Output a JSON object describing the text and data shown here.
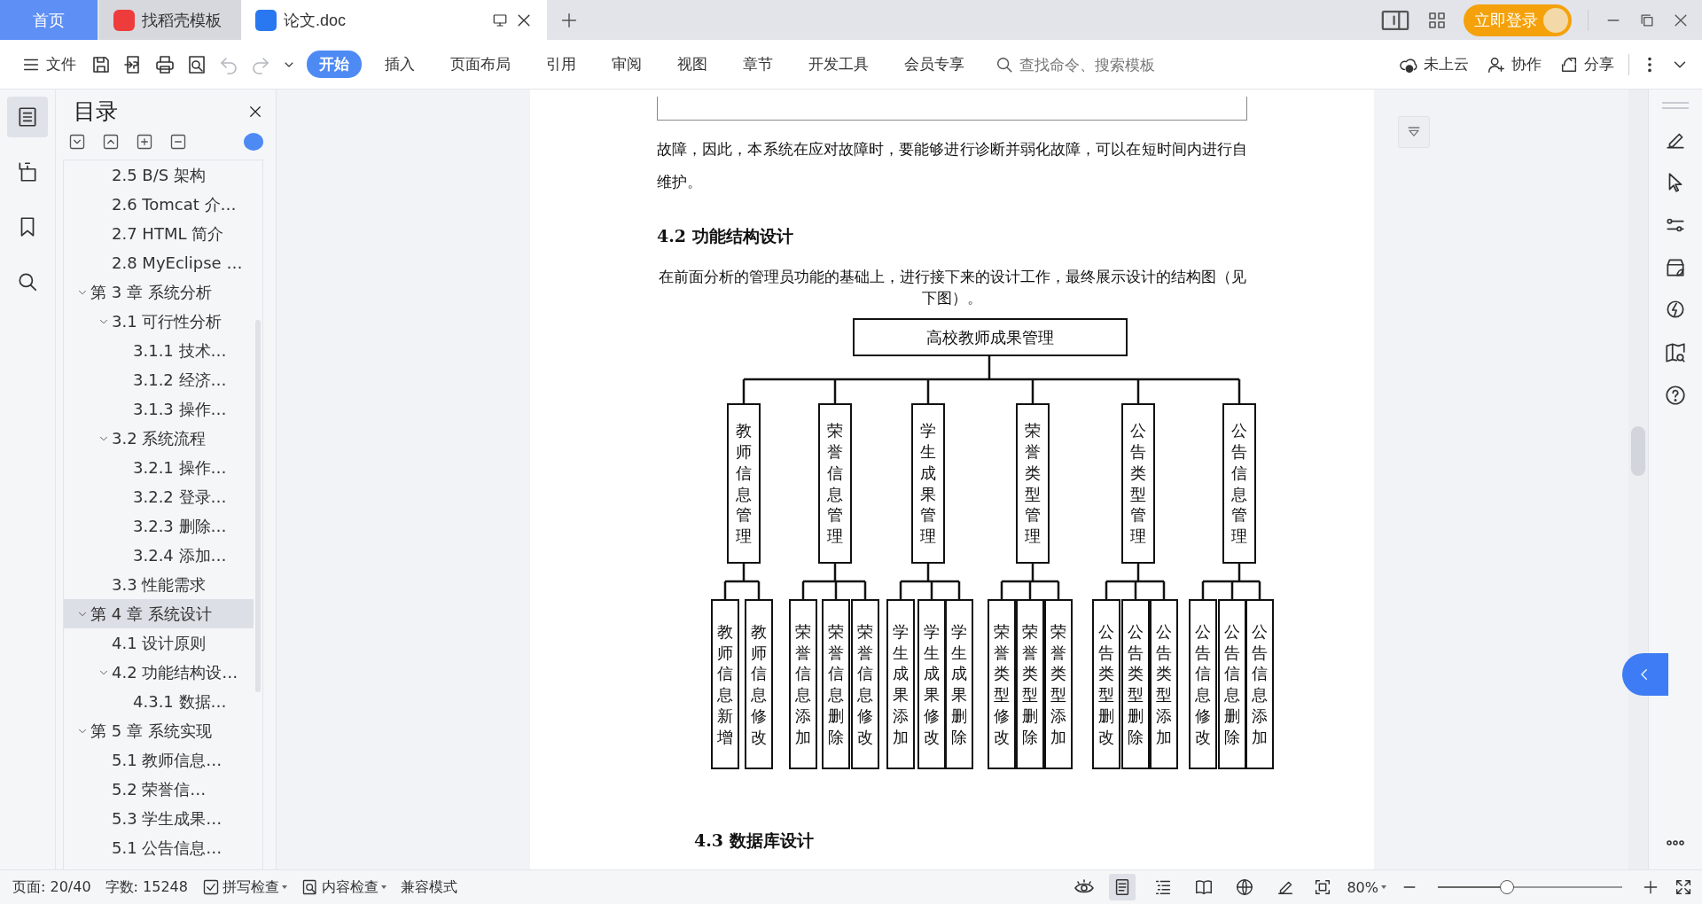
{
  "title_tabs": [
    {
      "kind": "home",
      "label": "首页",
      "selected": false
    },
    {
      "kind": "template",
      "label": "找稻壳模板",
      "selected": false
    },
    {
      "kind": "document",
      "label": "论文.doc",
      "selected": true
    }
  ],
  "login_button": "立即登录",
  "file_menu": "文件",
  "undo": {
    "disabled": true
  },
  "redo": {
    "disabled": true
  },
  "ribbon_tabs": [
    {
      "label": "开始",
      "selected": true
    },
    {
      "label": "插入",
      "selected": false
    },
    {
      "label": "页面布局",
      "selected": false
    },
    {
      "label": "引用",
      "selected": false
    },
    {
      "label": "审阅",
      "selected": false
    },
    {
      "label": "视图",
      "selected": false
    },
    {
      "label": "章节",
      "selected": false
    },
    {
      "label": "开发工具",
      "selected": false
    },
    {
      "label": "会员专享",
      "selected": false
    }
  ],
  "search": {
    "placeholder": "查找命令、搜索模板"
  },
  "toolbar_actions": [
    "未上云",
    "协作",
    "分享"
  ],
  "left_rail": [
    {
      "selected": true
    },
    {
      "selected": false
    },
    {
      "selected": false
    },
    {
      "selected": false
    }
  ],
  "toc": {
    "title": "目录",
    "continued": [
      {
        "label": "2.5 B/S 架构",
        "selected": false
      },
      {
        "label": "2.6 Tomcat 介…",
        "selected": false
      },
      {
        "label": "2.7 HTML 简介",
        "selected": false
      },
      {
        "label": "2.8 MyEclipse …",
        "selected": false
      }
    ],
    "items": [
      {
        "label": "第 3 章  系统分析",
        "selected": false,
        "expanded": true,
        "children": [
          {
            "label": "3.1  可行性分析",
            "selected": false,
            "expanded": true,
            "children": [
              {
                "label": "3.1.1  技术…",
                "selected": false
              },
              {
                "label": "3.1.2  经济…",
                "selected": false
              },
              {
                "label": "3.1.3  操作…",
                "selected": false
              }
            ]
          },
          {
            "label": "3.2  系统流程",
            "selected": false,
            "expanded": true,
            "children": [
              {
                "label": "3.2.1  操作…",
                "selected": false
              },
              {
                "label": "3.2.2  登录…",
                "selected": false
              },
              {
                "label": "3.2.3  删除…",
                "selected": false
              },
              {
                "label": "3.2.4  添加…",
                "selected": false
              }
            ]
          },
          {
            "label": "3.3  性能需求",
            "selected": false
          }
        ]
      },
      {
        "label": "第 4 章  系统设计",
        "selected": true,
        "expanded": true,
        "children": [
          {
            "label": "4.1  设计原则",
            "selected": false
          },
          {
            "label": "4.2  功能结构设…",
            "selected": false,
            "expanded": true,
            "children": [
              {
                "label": "4.3.1  数据…",
                "selected": false
              }
            ]
          }
        ]
      },
      {
        "label": "第 5 章  系统实现",
        "selected": false,
        "expanded": true,
        "children": [
          {
            "label": "5.1 教师信息…",
            "selected": false
          },
          {
            "label": "5.2  荣誉信…",
            "selected": false
          },
          {
            "label": "5.3 学生成果…",
            "selected": false
          },
          {
            "label": "5.1 公告信息…",
            "selected": false
          }
        ]
      }
    ]
  },
  "document": {
    "paragraph_1": "故障，因此，本系统在应对故障时，要能够进行诊断并弱化故障，可以在短时间内进行自维护。",
    "heading_1": "4.2  功能结构设计",
    "paragraph_2": "在前面分析的管理员功能的基础上，进行接下来的设计工作，最终展示设计的结构图（见下图）。",
    "chart": {
      "root": "高校教师成果管理",
      "groups": [
        {
          "label": "教师信息管理",
          "children": [
            "教师信息新增",
            "教师信息修改"
          ]
        },
        {
          "label": "荣誉信息管理",
          "children": [
            "荣誉信息添加",
            "荣誉信息删除",
            "荣誉信息修改"
          ]
        },
        {
          "label": "学生成果管理",
          "children": [
            "学生成果添加",
            "学生成果修改",
            "学生成果删除"
          ]
        },
        {
          "label": "荣誉类型管理",
          "children": [
            "荣誉类型修改",
            "荣誉类型删除",
            "荣誉类型添加"
          ]
        },
        {
          "label": "公告类型管理",
          "children": [
            "公告类型删改",
            "公告类型删除",
            "公告类型添加"
          ]
        },
        {
          "label": "公告信息管理",
          "children": [
            "公告信息修改",
            "公告信息删除",
            "公告信息添加"
          ]
        }
      ]
    },
    "heading_2": "4.3  数据库设计"
  },
  "status": {
    "page": "页面: 20/40",
    "words": "字数: 15248",
    "spell_check": "拼写检查",
    "content_check": "内容检查",
    "compat_mode": "兼容模式"
  },
  "view_modes": [
    {
      "selected": true
    },
    {
      "selected": false
    },
    {
      "selected": false
    },
    {
      "selected": false
    },
    {
      "selected": false
    }
  ],
  "zoom": {
    "reading": "80%",
    "level": 0.375
  }
}
